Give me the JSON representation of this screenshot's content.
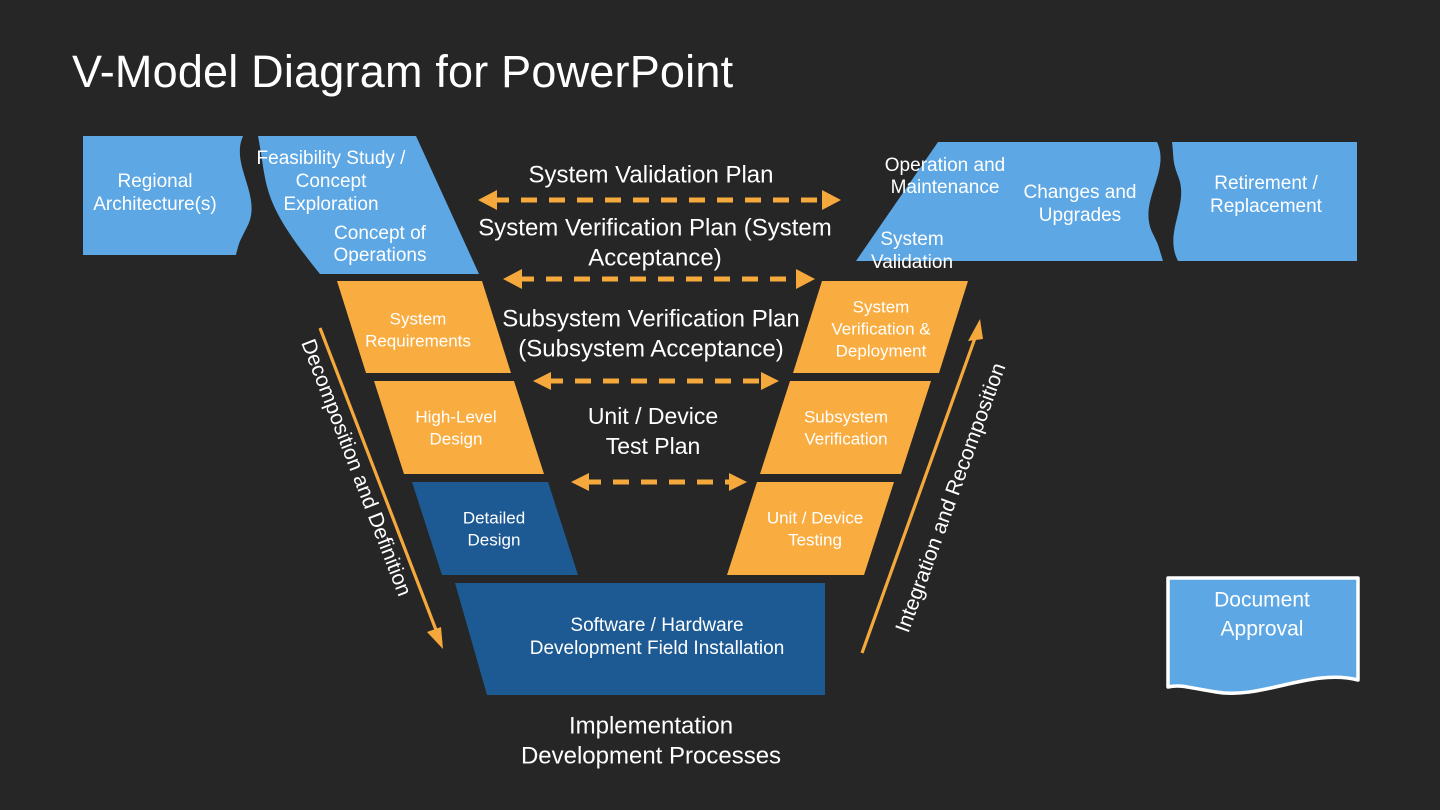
{
  "page": {
    "title": "V-Model Diagram for PowerPoint",
    "background_color": "#262626"
  },
  "colors": {
    "light_blue": "#5ca7e4",
    "orange": "#f9ad41",
    "dark_blue": "#1d5a94",
    "white": "#ffffff",
    "arrow_orange": "#f5a93c",
    "background": "#262626"
  },
  "chart_data": {
    "type": "diagram",
    "diagram_kind": "v-model",
    "title": "V-Model Diagram for PowerPoint",
    "left_arm_label": "Decomposition and Definition",
    "right_arm_label": "Integration and Recomposition",
    "bottom_caption_line1": "Implementation",
    "bottom_caption_line2": "Development Processes",
    "left_stages": [
      {
        "label": "Regional Architecture(s)",
        "color": "#5ca7e4",
        "level": 0
      },
      {
        "label": "Feasibility Study / Concept Exploration",
        "color": "#5ca7e4",
        "level": 0
      },
      {
        "label": "Concept of Operations",
        "color": "#5ca7e4",
        "level": 1
      },
      {
        "label": "System Requirements",
        "color": "#f9ad41",
        "level": 2
      },
      {
        "label": "High-Level Design",
        "color": "#f9ad41",
        "level": 3
      },
      {
        "label": "Detailed Design",
        "color": "#1d5a94",
        "level": 4
      }
    ],
    "bottom_stage": {
      "label": "Software / Hardware Development Field Installation",
      "color": "#1d5a94"
    },
    "right_stages": [
      {
        "label": "Unit / Device Testing",
        "color": "#f9ad41",
        "level": 4
      },
      {
        "label": "Subsystem Verification",
        "color": "#f9ad41",
        "level": 3
      },
      {
        "label": "System Verification & Deployment",
        "color": "#f9ad41",
        "level": 2
      },
      {
        "label": "System Validation",
        "color": "#5ca7e4",
        "level": 1
      },
      {
        "label": "Operation and Maintenance",
        "color": "#5ca7e4",
        "level": 0
      },
      {
        "label": "Changes and Upgrades",
        "color": "#5ca7e4",
        "level": 0
      },
      {
        "label": "Retirement / Replacement",
        "color": "#5ca7e4",
        "level": 0
      }
    ],
    "cross_links": [
      "System Validation Plan",
      "System Verification Plan (System Acceptance)",
      "Subsystem Verification Plan (Subsystem Acceptance)",
      "Unit / Device Test Plan"
    ]
  },
  "left_blocks": {
    "regional_architecture_l1": "Regional",
    "regional_architecture_l2": "Architecture(s)",
    "feasibility_l1": "Feasibility Study /",
    "feasibility_l2": "Concept",
    "feasibility_l3": "Exploration",
    "concept_ops_l1": "Concept of",
    "concept_ops_l2": "Operations",
    "system_requirements_l1": "System",
    "system_requirements_l2": "Requirements",
    "high_level_design_l1": "High-Level",
    "high_level_design_l2": "Design",
    "detailed_design_l1": "Detailed",
    "detailed_design_l2": "Design"
  },
  "right_blocks": {
    "operation_maintenance_l1": "Operation and",
    "operation_maintenance_l2": "Maintenance",
    "changes_upgrades_l1": "Changes and",
    "changes_upgrades_l2": "Upgrades",
    "retirement_l1": "Retirement /",
    "retirement_l2": "Replacement",
    "system_validation_l1": "System",
    "system_validation_l2": "Validation",
    "system_verification_l1": "System",
    "system_verification_l2": "Verification &",
    "system_verification_l3": "Deployment",
    "subsystem_verification_l1": "Subsystem",
    "subsystem_verification_l2": "Verification",
    "unit_device_testing_l1": "Unit / Device",
    "unit_device_testing_l2": "Testing"
  },
  "center_labels": {
    "system_validation_plan": "System Validation Plan",
    "system_verification_plan_l1": "System Verification Plan (System",
    "system_verification_plan_l2": "Acceptance)",
    "subsystem_verification_plan_l1": "Subsystem Verification Plan",
    "subsystem_verification_plan_l2": "(Subsystem Acceptance)",
    "unit_device_test_plan_l1": "Unit / Device",
    "unit_device_test_plan_l2": "Test Plan"
  },
  "bottom_block": {
    "line1": "Software / Hardware",
    "line2": "Development Field Installation"
  },
  "bottom_caption": {
    "line1": "Implementation",
    "line2": "Development Processes"
  },
  "side_arrows": {
    "left": "Decomposition and Definition",
    "right": "Integration and Recomposition"
  },
  "document_approval": {
    "line1": "Document",
    "line2": "Approval"
  }
}
